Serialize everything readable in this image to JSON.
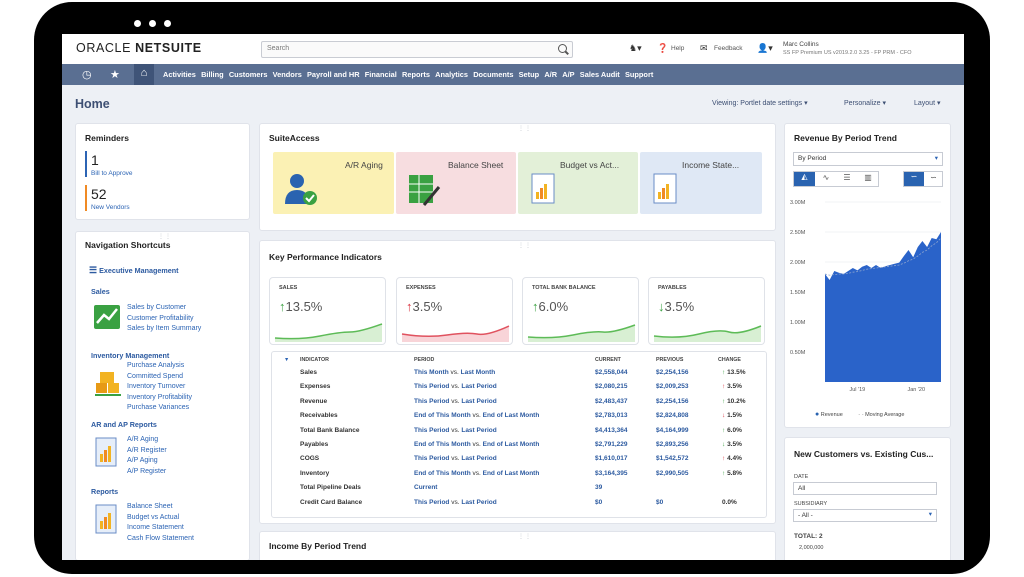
{
  "header": {
    "logo_prefix": "ORACLE",
    "logo_brand": "NETSUITE",
    "search_placeholder": "Search",
    "help": "Help",
    "feedback": "Feedback",
    "user_name": "Marc Collins",
    "user_role": "SS FP Premium US v2019.2.0 3.25 - FP PRM - CFO"
  },
  "nav": {
    "items": [
      "Activities",
      "Billing",
      "Customers",
      "Vendors",
      "Payroll and HR",
      "Financial",
      "Reports",
      "Analytics",
      "Documents",
      "Setup",
      "A/R",
      "A/P",
      "Sales Audit",
      "Support"
    ]
  },
  "page": {
    "title": "Home",
    "viewing": "Viewing: Portlet date settings",
    "personalize": "Personalize",
    "layout": "Layout"
  },
  "reminders": {
    "title": "Reminders",
    "items": [
      {
        "count": "1",
        "label": "Bill to Approve",
        "color": "#2c64b4"
      },
      {
        "count": "52",
        "label": "New Vendors",
        "color": "#f08a24"
      }
    ]
  },
  "navigation": {
    "title": "Navigation Shortcuts",
    "exec": "Executive Management",
    "sales_h": "Sales",
    "sales": [
      "Sales by Customer",
      "Customer Profitability",
      "Sales by Item Summary"
    ],
    "inv_h": "Inventory Management",
    "inv": [
      "Purchase Analysis",
      "Committed Spend",
      "Inventory Turnover",
      "Inventory Profitability",
      "Purchase Variances"
    ],
    "arap_h": "AR and AP Reports",
    "arap": [
      "A/R Aging",
      "A/R Register",
      "A/P Aging",
      "A/P Register"
    ],
    "rep_h": "Reports",
    "rep": [
      "Balance Sheet",
      "Budget vs Actual",
      "Income Statement",
      "Cash Flow Statement"
    ]
  },
  "suiteaccess": {
    "title": "SuiteAccess",
    "tiles": [
      {
        "label": "A/R Aging",
        "color": "#fbf1b4"
      },
      {
        "label": "Balance Sheet",
        "color": "#f7dde0"
      },
      {
        "label": "Budget vs Act...",
        "color": "#e3f0d8"
      },
      {
        "label": "Income State...",
        "color": "#dfe8f5"
      }
    ]
  },
  "kpi": {
    "title": "Key Performance Indicators",
    "cards": [
      {
        "label": "SALES",
        "value": "13.5%",
        "dir": "up",
        "color": "#5dbb57"
      },
      {
        "label": "EXPENSES",
        "value": "3.5%",
        "dir": "up-red",
        "color": "#e0525f"
      },
      {
        "label": "TOTAL BANK BALANCE",
        "value": "6.0%",
        "dir": "up",
        "color": "#5dbb57"
      },
      {
        "label": "PAYABLES",
        "value": "3.5%",
        "dir": "down-green",
        "color": "#5dbb57"
      }
    ],
    "columns": [
      "INDICATOR",
      "PERIOD",
      "CURRENT",
      "PREVIOUS",
      "CHANGE"
    ],
    "rows": [
      {
        "indicator": "Sales",
        "period_a": "This Month",
        "period_b": "Last Month",
        "current": "$2,558,044",
        "previous": "$2,254,156",
        "change": "13.5%",
        "dir": "up"
      },
      {
        "indicator": "Expenses",
        "period_a": "This Period",
        "period_b": "Last Period",
        "current": "$2,080,215",
        "previous": "$2,009,253",
        "change": "3.5%",
        "dir": "up-red"
      },
      {
        "indicator": "Revenue",
        "period_a": "This Period",
        "period_b": "Last Period",
        "current": "$2,483,437",
        "previous": "$2,254,156",
        "change": "10.2%",
        "dir": "up"
      },
      {
        "indicator": "Receivables",
        "period_a": "End of This Month",
        "period_b": "End of Last Month",
        "current": "$2,783,013",
        "previous": "$2,824,808",
        "change": "1.5%",
        "dir": "down-red"
      },
      {
        "indicator": "Total Bank Balance",
        "period_a": "This Period",
        "period_b": "Last Period",
        "current": "$4,413,364",
        "previous": "$4,164,999",
        "change": "6.0%",
        "dir": "up"
      },
      {
        "indicator": "Payables",
        "period_a": "End of This Month",
        "period_b": "End of Last Month",
        "current": "$2,791,229",
        "previous": "$2,893,256",
        "change": "3.5%",
        "dir": "down-green"
      },
      {
        "indicator": "COGS",
        "period_a": "This Period",
        "period_b": "Last Period",
        "current": "$1,610,017",
        "previous": "$1,542,572",
        "change": "4.4%",
        "dir": "up-red"
      },
      {
        "indicator": "Inventory",
        "period_a": "End of This Month",
        "period_b": "End of Last Month",
        "current": "$3,164,395",
        "previous": "$2,990,505",
        "change": "5.8%",
        "dir": "up"
      },
      {
        "indicator": "Total Pipeline Deals",
        "period_a": "Current",
        "period_b": "",
        "current": "39",
        "previous": "",
        "change": "",
        "dir": ""
      },
      {
        "indicator": "Credit Card Balance",
        "period_a": "This Period",
        "period_b": "Last Period",
        "current": "$0",
        "previous": "$0",
        "change": "0.0%",
        "dir": ""
      }
    ],
    "vs": "vs."
  },
  "income_trend": {
    "title": "Income By Period Trend"
  },
  "revenue_trend": {
    "title": "Revenue By Period Trend",
    "select": "By Period",
    "legend_revenue": "Revenue",
    "legend_avg": "Moving Average"
  },
  "chart_data": {
    "type": "area",
    "title": "Revenue By Period Trend",
    "ylim": [
      0,
      3000000
    ],
    "yticks": [
      "0.50M",
      "1.00M",
      "1.50M",
      "2.00M",
      "2.50M",
      "3.00M"
    ],
    "xticks": [
      "Jul '19",
      "Jan '20"
    ],
    "series": [
      {
        "name": "Revenue",
        "values": [
          1.8,
          1.7,
          1.85,
          1.82,
          1.8,
          1.85,
          1.9,
          1.86,
          1.92,
          1.95,
          1.9,
          1.95,
          1.9,
          1.93,
          1.95,
          1.97,
          1.99,
          2.1,
          2.2,
          2.08,
          2.25,
          2.35,
          2.25,
          2.4,
          2.38,
          2.5
        ]
      },
      {
        "name": "Moving Average",
        "values": [
          1.8,
          1.78,
          1.79,
          1.8,
          1.8,
          1.81,
          1.83,
          1.84,
          1.86,
          1.88,
          1.89,
          1.9,
          1.91,
          1.92,
          1.93,
          1.94,
          1.95,
          1.98,
          2.02,
          2.05,
          2.1,
          2.16,
          2.2,
          2.27,
          2.32,
          2.4
        ]
      }
    ]
  },
  "new_customers": {
    "title": "New Customers vs. Existing Cus...",
    "date_label": "DATE",
    "date_value": "All",
    "subsidiary_label": "SUBSIDIARY",
    "subsidiary_value": "- All -",
    "total_label": "TOTAL: 2",
    "axis_top": "2,000,000"
  }
}
